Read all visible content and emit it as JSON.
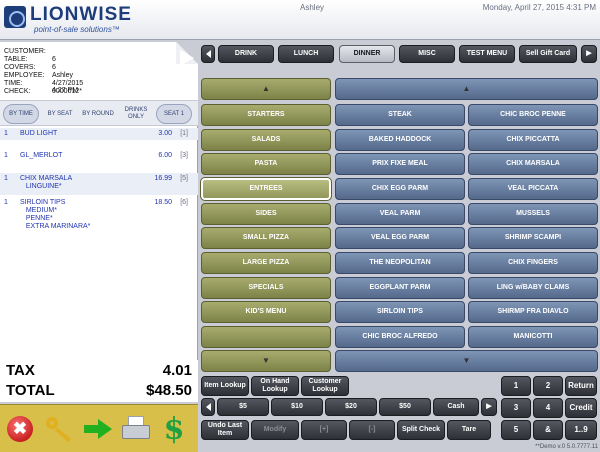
{
  "header": {
    "brand_name": "LIONWISE",
    "brand_tagline": "point-of-sale solutions™",
    "user": "Ashley",
    "datetime": "Monday, April 27, 2015 4:31 PM"
  },
  "check": {
    "info": [
      {
        "label": "CUSTOMER:",
        "value": ""
      },
      {
        "label": "TABLE:",
        "value": "6"
      },
      {
        "label": "COVERS:",
        "value": "6"
      },
      {
        "label": "EMPLOYEE:",
        "value": "Ashley"
      },
      {
        "label": "TIME:",
        "value": "4/27/2015 4:27 PM"
      },
      {
        "label": "CHECK:",
        "value": "0000012*"
      }
    ],
    "sort_options": [
      "BY TIME",
      "BY SEAT",
      "BY ROUND",
      "DRINKS ONLY",
      "SEAT 1"
    ],
    "items": [
      {
        "qty": "1",
        "name": "BUD LIGHT",
        "price": "3.00",
        "seat": "[1]"
      },
      {
        "qty": "1",
        "name": "GL_MERLOT",
        "price": "6.00",
        "seat": "[3]"
      },
      {
        "qty": "1",
        "name": "CHIX MARSALA\n   LINGUINE*",
        "price": "16.99",
        "seat": "[5]"
      },
      {
        "qty": "1",
        "name": "SIRLOIN TIPS\n   MEDIUM*\n   PENNE*\n   EXTRA MARINARA*",
        "price": "18.50",
        "seat": "[6]"
      }
    ],
    "tax_label": "TAX",
    "tax_value": "4.01",
    "total_label": "TOTAL",
    "total_value": "$48.50"
  },
  "categories": [
    "DRINK",
    "LUNCH",
    "DINNER",
    "MISC",
    "TEST MENU",
    "Sell Gift Card"
  ],
  "groups": [
    "STARTERS",
    "SALADS",
    "PASTA",
    "ENTREES",
    "SIDES",
    "SMALL PIZZA",
    "LARGE PIZZA",
    "SPECIALS",
    "KID'S MENU"
  ],
  "menu_items": [
    "STEAK",
    "CHIC BROC PENNE",
    "BAKED HADDOCK",
    "CHIX PICCATTA",
    "PRIX FIXE MEAL",
    "CHIX MARSALA",
    "CHIX EGG PARM",
    "VEAL PICCATA",
    "VEAL PARM",
    "MUSSELS",
    "VEAL EGG PARM",
    "SHRIMP SCAMPI",
    "THE NEOPOLITAN",
    "CHIX FINGERS",
    "EGGPLANT PARM",
    "LING w/BABY CLAMS",
    "SIRLOIN TIPS",
    "SHIRMP FRA DIAVLO",
    "CHIC BROC ALFREDO",
    "MANICOTTI"
  ],
  "lookup_buttons": [
    "Item Lookup",
    "On Hand Lookup",
    "Customer Lookup"
  ],
  "cash_buttons": [
    "$5",
    "$10",
    "$20",
    "$50",
    "Cash"
  ],
  "function_buttons": [
    "Undo Last Item",
    "Modify",
    "[+]",
    "[-]",
    "Split Check",
    "Tare"
  ],
  "keypad": [
    "1",
    "2",
    "Return",
    "3",
    "4",
    "Credit",
    "5",
    "&",
    "1..9"
  ],
  "version": "**Demo v.0 5.0.7777.11",
  "icons": {
    "up": "▲",
    "down": "▼",
    "right": "▶",
    "cancel": "✖",
    "cash": "$"
  },
  "colors": {
    "brand": "#1d3d7a",
    "olive_button": "#8f9456",
    "blue_button": "#6a7fa2",
    "dark_button": "#3c3e45",
    "item_text": "#2034b0",
    "toolbar": "#d8bf4a"
  }
}
